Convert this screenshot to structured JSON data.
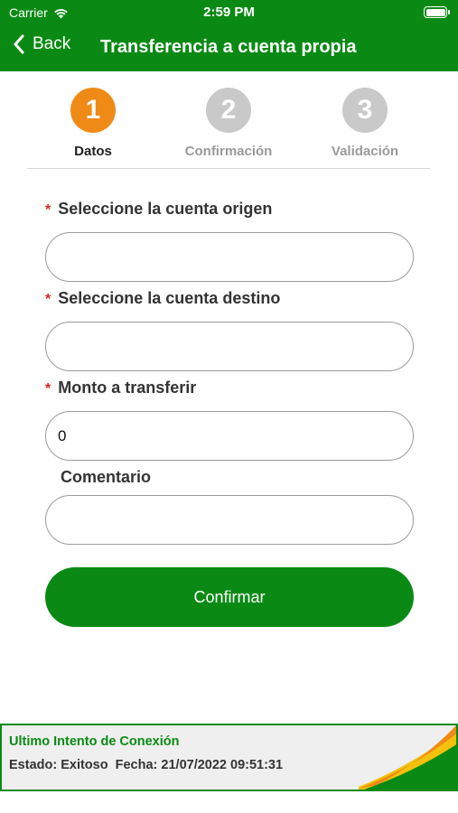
{
  "status_bar": {
    "carrier": "Carrier",
    "time": "2:59 PM"
  },
  "nav": {
    "back_label": "Back",
    "title": "Transferencia a cuenta propia"
  },
  "steps": [
    {
      "number": "1",
      "label": "Datos",
      "state": "active"
    },
    {
      "number": "2",
      "label": "Confirmación",
      "state": "inactive"
    },
    {
      "number": "3",
      "label": "Validación",
      "state": "inactive"
    }
  ],
  "form": {
    "required_mark": "*",
    "origin_label": "Seleccione la cuenta origen",
    "origin_value": "",
    "destination_label": "Seleccione la cuenta destino",
    "destination_value": "",
    "amount_label": "Monto a transferir",
    "amount_value": "0",
    "comment_label": "Comentario",
    "comment_value": "",
    "confirm_label": "Confirmar"
  },
  "footer": {
    "title": "Ultimo Intento de Conexión",
    "status_label": "Estado:",
    "status_value": "Exitoso",
    "date_label": "Fecha:",
    "date_value": "21/07/2022 09:51:31"
  },
  "colors": {
    "brand_green": "#0a8a14",
    "active_step": "#f08a16",
    "inactive_step": "#c9c9c9",
    "required": "#d9251d"
  }
}
